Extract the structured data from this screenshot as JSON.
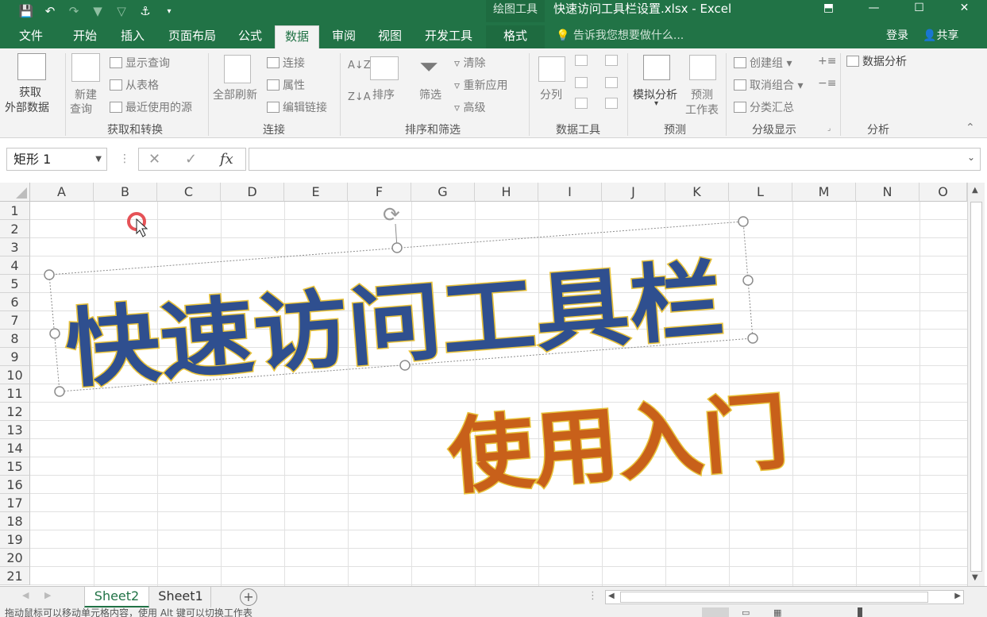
{
  "titlebar": {
    "context_tool": "绘图工具",
    "document_title": "快速访问工具栏设置.xlsx - Excel"
  },
  "tabs": [
    {
      "label": "文件"
    },
    {
      "label": "开始"
    },
    {
      "label": "插入"
    },
    {
      "label": "页面布局"
    },
    {
      "label": "公式"
    },
    {
      "label": "数据"
    },
    {
      "label": "审阅"
    },
    {
      "label": "视图"
    },
    {
      "label": "开发工具"
    },
    {
      "label": "格式"
    }
  ],
  "active_tab": "数据",
  "tell_me": "告诉我您想要做什么...",
  "sign_in": "登录",
  "share": "共享",
  "ribbon": {
    "get_external_line1": "获取",
    "get_external_line2": "外部数据",
    "new_query_line1": "新建",
    "new_query_line2": "查询",
    "show_queries": "显示查询",
    "from_table": "从表格",
    "recent_sources": "最近使用的源",
    "group_get_transform": "获取和转换",
    "refresh_all": "全部刷新",
    "connections": "连接",
    "properties": "属性",
    "edit_links": "编辑链接",
    "group_connections": "连接",
    "sort": "排序",
    "filter": "筛选",
    "clear": "清除",
    "reapply": "重新应用",
    "advanced": "高级",
    "group_sort_filter": "排序和筛选",
    "text_to_columns": "分列",
    "group_data_tools": "数据工具",
    "what_if": "模拟分析",
    "forecast_line1": "预测",
    "forecast_line2": "工作表",
    "group_forecast": "预测",
    "group_label": "创建组",
    "ungroup": "取消组合",
    "subtotal": "分类汇总",
    "group_outline": "分级显示",
    "data_analysis": "数据分析",
    "group_analysis": "分析"
  },
  "formula_bar": {
    "name_box": "矩形 1",
    "fx": "fx",
    "formula": ""
  },
  "columns": [
    "A",
    "B",
    "C",
    "D",
    "E",
    "F",
    "G",
    "H",
    "I",
    "J",
    "K",
    "L",
    "M",
    "N",
    "O"
  ],
  "rows": [
    "1",
    "2",
    "3",
    "4",
    "5",
    "6",
    "7",
    "8",
    "9",
    "10",
    "11",
    "12",
    "13",
    "14",
    "15",
    "16",
    "17",
    "18",
    "19",
    "20",
    "21"
  ],
  "overlay_text": {
    "main": "快速访问工具栏",
    "sub": "使用入门"
  },
  "sheets": [
    {
      "label": "Sheet2"
    },
    {
      "label": "Sheet1"
    }
  ],
  "status_text": "拖动鼠标可以移动单元格内容，使用 Alt 键可以切换工作表",
  "colors": {
    "excel_green": "#217346",
    "title_blue": "#2f4f8f",
    "sub_orange": "#c8601a",
    "text_outline": "#e8c23a"
  }
}
